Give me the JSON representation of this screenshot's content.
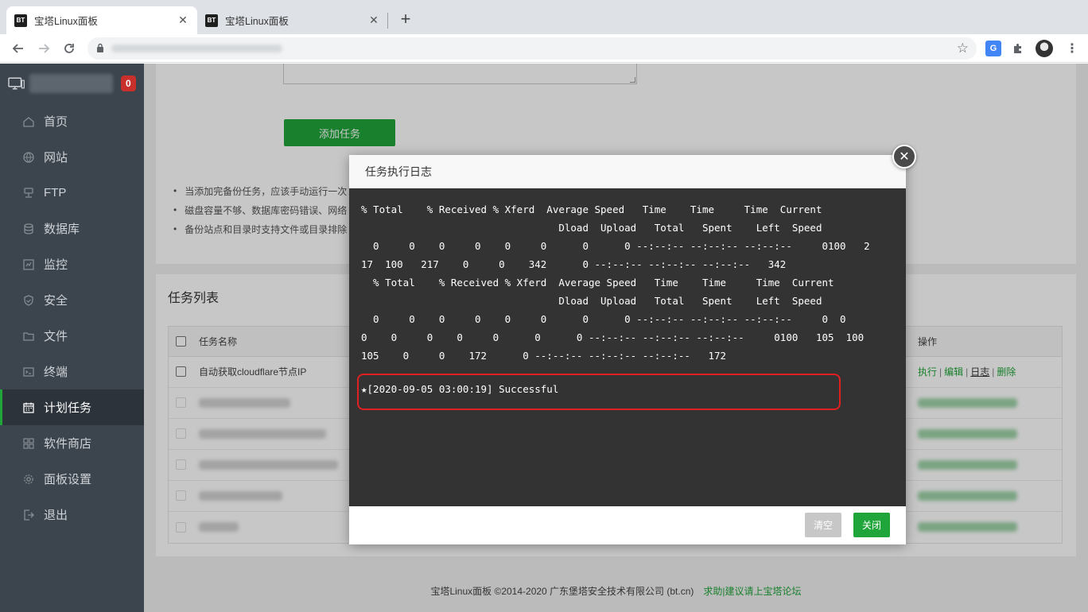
{
  "browser": {
    "tabs": [
      {
        "favicon": "BT",
        "title": "宝塔Linux面板"
      },
      {
        "favicon": "BT",
        "title": "宝塔Linux面板"
      }
    ],
    "new_tab": "+",
    "translate_label": "G"
  },
  "sidebar": {
    "alert_count": "0",
    "items": [
      {
        "label": "首页",
        "icon": "home-icon"
      },
      {
        "label": "网站",
        "icon": "globe-icon"
      },
      {
        "label": "FTP",
        "icon": "ftp-icon"
      },
      {
        "label": "数据库",
        "icon": "database-icon"
      },
      {
        "label": "监控",
        "icon": "monitor-icon"
      },
      {
        "label": "安全",
        "icon": "shield-icon"
      },
      {
        "label": "文件",
        "icon": "folder-icon"
      },
      {
        "label": "终端",
        "icon": "terminal-icon"
      },
      {
        "label": "计划任务",
        "icon": "calendar-icon"
      },
      {
        "label": "软件商店",
        "icon": "apps-icon"
      },
      {
        "label": "面板设置",
        "icon": "gear-icon"
      },
      {
        "label": "退出",
        "icon": "logout-icon"
      }
    ],
    "active_index": 8
  },
  "page": {
    "add_task_label": "添加任务",
    "tips": [
      "当添加完备份任务，应该手动运行一次",
      "磁盘容量不够、数据库密码错误、网络",
      "备份站点和目录时支持文件或目录排除"
    ],
    "task_list_title": "任务列表",
    "table": {
      "col_name": "任务名称",
      "col_ops": "操作",
      "first_row_name": "自动获取cloudflare节点IP",
      "ops": [
        "执行",
        "编辑",
        "日志",
        "删除"
      ]
    },
    "footer_copyright": "宝塔Linux面板 ©2014-2020 广东堡塔安全技术有限公司 (bt.cn)",
    "footer_link": "求助|建议请上宝塔论坛"
  },
  "modal": {
    "title": "任务执行日志",
    "close_glyph": "✕",
    "log_text": "% Total    % Received % Xferd  Average Speed   Time    Time     Time  Current\n                                 Dload  Upload   Total   Spent    Left  Speed\n  0     0    0     0    0     0      0      0 --:--:-- --:--:-- --:--:--     0100   2\n17  100   217    0     0    342      0 --:--:-- --:--:-- --:--:--   342\n  % Total    % Received % Xferd  Average Speed   Time    Time     Time  Current\n                                 Dload  Upload   Total   Spent    Left  Speed\n  0     0    0     0    0     0      0      0 --:--:-- --:--:-- --:--:--     0  0\n0    0     0    0     0      0      0 --:--:-- --:--:-- --:--:--     0100   105  100\n105    0     0    172      0 --:--:-- --:--:-- --:--:--   172",
    "result_line": "★[2020-09-05 03:00:19] Successful",
    "clear_label": "清空",
    "close_label": "关闭"
  },
  "colors": {
    "brand_green": "#20a53a",
    "sidebar_bg": "#3c444d",
    "highlight_red": "#e02020",
    "console_bg": "#333333"
  }
}
